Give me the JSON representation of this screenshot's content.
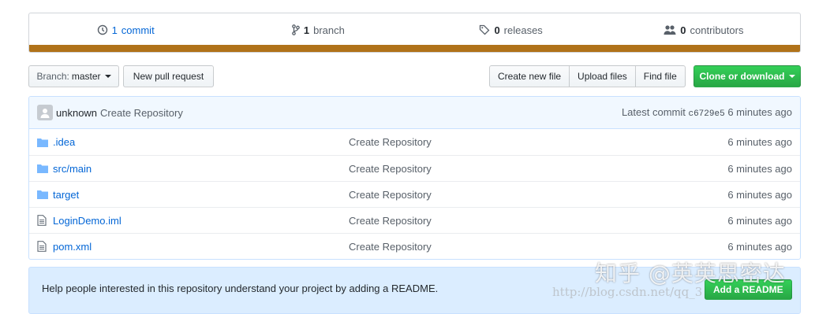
{
  "summary": {
    "commits": {
      "count": "1",
      "label": "commit",
      "icon": "history-icon"
    },
    "branches": {
      "count": "1",
      "label": "branch",
      "icon": "branch-icon"
    },
    "releases": {
      "count": "0",
      "label": "releases",
      "icon": "tag-icon"
    },
    "contributors": {
      "count": "0",
      "label": "contributors",
      "icon": "people-icon"
    },
    "language_bar_color": "#b07219"
  },
  "toolbar": {
    "branch_prefix": "Branch:",
    "branch_name": "master",
    "new_pull_request": "New pull request",
    "create_new_file": "Create new file",
    "upload_files": "Upload files",
    "find_file": "Find file",
    "clone_or_download": "Clone or download"
  },
  "commit_tease": {
    "author": "unknown",
    "message": "Create Repository",
    "latest_label": "Latest commit",
    "sha": "c6729e5",
    "age": "6 minutes ago"
  },
  "files": [
    {
      "type": "folder",
      "name": ".idea",
      "message": "Create Repository",
      "age": "6 minutes ago"
    },
    {
      "type": "folder",
      "name": "src/main",
      "message": "Create Repository",
      "age": "6 minutes ago"
    },
    {
      "type": "folder",
      "name": "target",
      "message": "Create Repository",
      "age": "6 minutes ago"
    },
    {
      "type": "file",
      "name": "LoginDemo.iml",
      "message": "Create Repository",
      "age": "6 minutes ago"
    },
    {
      "type": "file",
      "name": "pom.xml",
      "message": "Create Repository",
      "age": "6 minutes ago"
    }
  ],
  "readme": {
    "text": "Help people interested in this repository understand your project by adding a README.",
    "button": "Add a README"
  },
  "watermark": {
    "line1": "知乎 @英英思密达",
    "line2": "http://blog.csdn.net/qq_3"
  },
  "colors": {
    "accent": "#0366d6",
    "green": "#28a745",
    "language": "#b07219"
  }
}
